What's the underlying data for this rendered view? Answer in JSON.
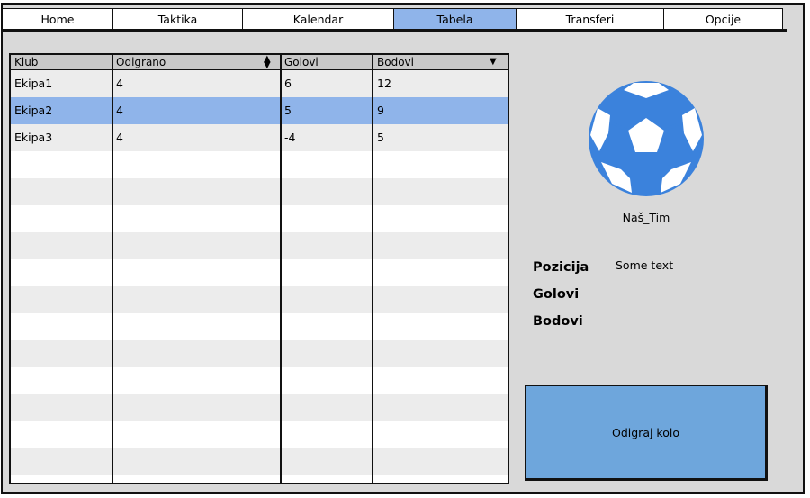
{
  "nav": {
    "tabs": [
      {
        "label": "Home",
        "active": false
      },
      {
        "label": "Taktika",
        "active": false
      },
      {
        "label": "Kalendar",
        "active": false
      },
      {
        "label": "Tabela",
        "active": true
      },
      {
        "label": "Transferi",
        "active": false
      },
      {
        "label": "Opcije",
        "active": false
      }
    ]
  },
  "table": {
    "columns": [
      "Klub",
      "Odigrano",
      "Golovi",
      "Bodovi"
    ],
    "rows": [
      [
        "Ekipa1",
        "4",
        "6",
        "12"
      ],
      [
        "Ekipa2",
        "4",
        "5",
        "9"
      ],
      [
        "Ekipa3",
        "4",
        "-4",
        "5"
      ]
    ],
    "selected_row": 1
  },
  "team": {
    "icon": "soccer-ball-icon",
    "name": "Naš_Tim",
    "labels": {
      "position": "Pozicija",
      "goals": "Golovi",
      "points": "Bodovi"
    },
    "position_value": "Some text"
  },
  "actions": {
    "play_round_label": "Odigraj kolo"
  },
  "colors": {
    "accent": "#8fb4ea",
    "button": "#6ea6dc",
    "ball": "#3b82dc"
  }
}
